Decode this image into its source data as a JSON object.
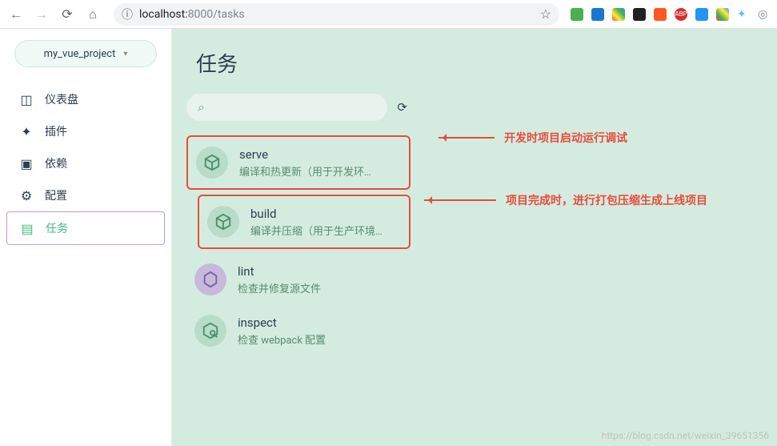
{
  "browser": {
    "url_host": "localhost:",
    "url_port": "8000",
    "url_path": "/tasks"
  },
  "sidebar": {
    "project_name": "my_vue_project",
    "items": [
      {
        "label": "仪表盘"
      },
      {
        "label": "插件"
      },
      {
        "label": "依赖"
      },
      {
        "label": "配置"
      },
      {
        "label": "任务"
      }
    ]
  },
  "page": {
    "title": "任务"
  },
  "tasks": [
    {
      "name": "serve",
      "desc": "编译和热更新（用于开发环…"
    },
    {
      "name": "build",
      "desc": "编译并压缩（用于生产环境…"
    },
    {
      "name": "lint",
      "desc": "检查并修复源文件"
    },
    {
      "name": "inspect",
      "desc": "检查 webpack 配置"
    }
  ],
  "annotations": [
    {
      "text": "开发时项目启动运行调试"
    },
    {
      "text": "项目完成时，进行打包压缩生成上线项目"
    }
  ],
  "watermark": "https://blog.csdn.net/weixin_39651356"
}
